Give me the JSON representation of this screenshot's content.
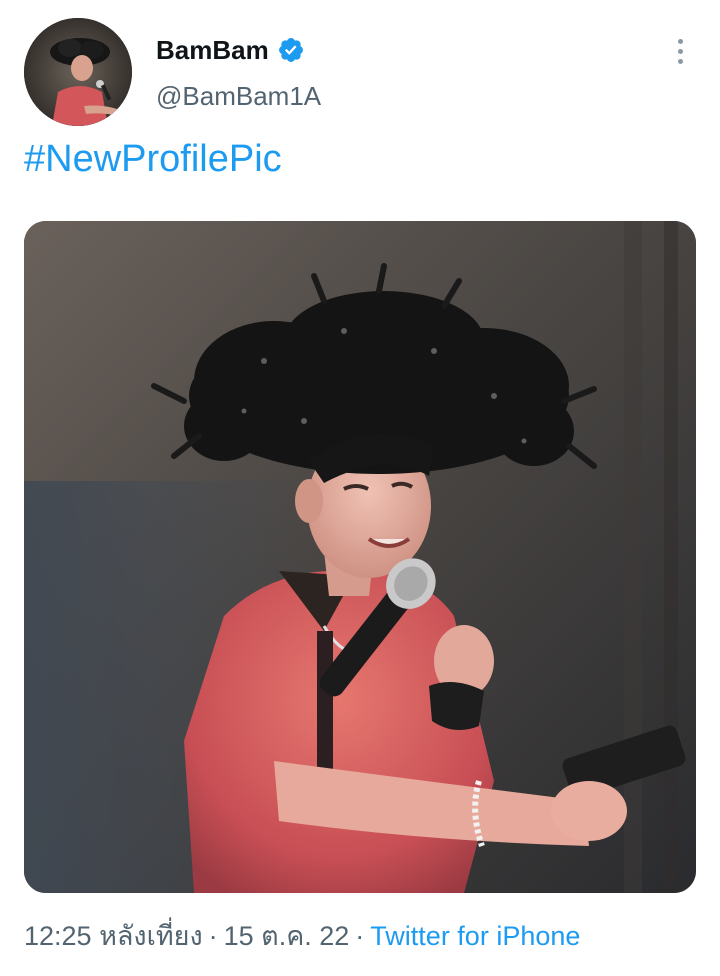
{
  "tweet": {
    "author": {
      "display_name": "BamBam",
      "handle": "@BamBam1A",
      "verified": true,
      "avatar_icon": "profile-photo"
    },
    "text": "#NewProfilePic",
    "media": {
      "type": "photo",
      "icon": "performer-photo"
    },
    "time": "12:25 หลังเที่ยง",
    "separator": "·",
    "date": "15 ต.ค. 22",
    "source": "Twitter for iPhone"
  },
  "colors": {
    "link": "#1d9bf0",
    "secondary_text": "#536471",
    "primary_text": "#0f1419",
    "verified_badge": "#1d9bf0"
  },
  "icons": {
    "verified": "verified-badge-icon",
    "more": "more-vertical-icon"
  }
}
